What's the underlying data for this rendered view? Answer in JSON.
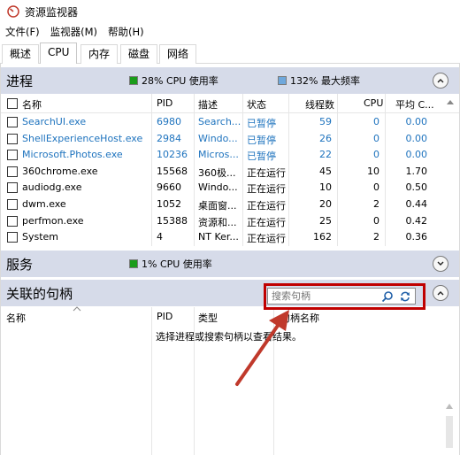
{
  "window": {
    "title": "资源监视器"
  },
  "menu": [
    "文件(F)",
    "监视器(M)",
    "帮助(H)"
  ],
  "tabs": [
    "概述",
    "CPU",
    "内存",
    "磁盘",
    "网络"
  ],
  "processes": {
    "title": "进程",
    "cpu_usage": "28% CPU 使用率",
    "max_freq": "132% 最大频率",
    "columns": [
      "名称",
      "PID",
      "描述",
      "状态",
      "线程数",
      "CPU",
      "平均 C..."
    ],
    "rows": [
      {
        "name": "SearchUI.exe",
        "pid": "6980",
        "desc": "Search...",
        "status": "已暂停",
        "threads": "59",
        "cpu": "0",
        "avg": "0.00",
        "suspended": true
      },
      {
        "name": "ShellExperienceHost.exe",
        "pid": "2984",
        "desc": "Windo...",
        "status": "已暂停",
        "threads": "26",
        "cpu": "0",
        "avg": "0.00",
        "suspended": true
      },
      {
        "name": "Microsoft.Photos.exe",
        "pid": "10236",
        "desc": "Micros...",
        "status": "已暂停",
        "threads": "22",
        "cpu": "0",
        "avg": "0.00",
        "suspended": true
      },
      {
        "name": "360chrome.exe",
        "pid": "15568",
        "desc": "360极...",
        "status": "正在运行",
        "threads": "45",
        "cpu": "10",
        "avg": "1.70",
        "suspended": false
      },
      {
        "name": "audiodg.exe",
        "pid": "9660",
        "desc": "Windo...",
        "status": "正在运行",
        "threads": "10",
        "cpu": "0",
        "avg": "0.50",
        "suspended": false
      },
      {
        "name": "dwm.exe",
        "pid": "1052",
        "desc": "桌面窗...",
        "status": "正在运行",
        "threads": "20",
        "cpu": "2",
        "avg": "0.44",
        "suspended": false
      },
      {
        "name": "perfmon.exe",
        "pid": "15388",
        "desc": "资源和...",
        "status": "正在运行",
        "threads": "25",
        "cpu": "0",
        "avg": "0.42",
        "suspended": false
      },
      {
        "name": "System",
        "pid": "4",
        "desc": "NT Ker...",
        "status": "正在运行",
        "threads": "162",
        "cpu": "2",
        "avg": "0.36",
        "suspended": false
      }
    ]
  },
  "services": {
    "title": "服务",
    "cpu_usage": "1% CPU 使用率"
  },
  "handles": {
    "title": "关联的句柄",
    "search_placeholder": "搜索句柄",
    "columns": [
      "名称",
      "PID",
      "类型",
      "句柄名称"
    ],
    "hint": "选择进程或搜索句柄以查看结果。"
  },
  "colors": {
    "header_bg": "#d6dbe9",
    "suspended_text": "#1e73be",
    "cpu_swatch": "#1a9c1a",
    "freq_swatch": "#6fa8dc",
    "highlight": "#c00000"
  }
}
